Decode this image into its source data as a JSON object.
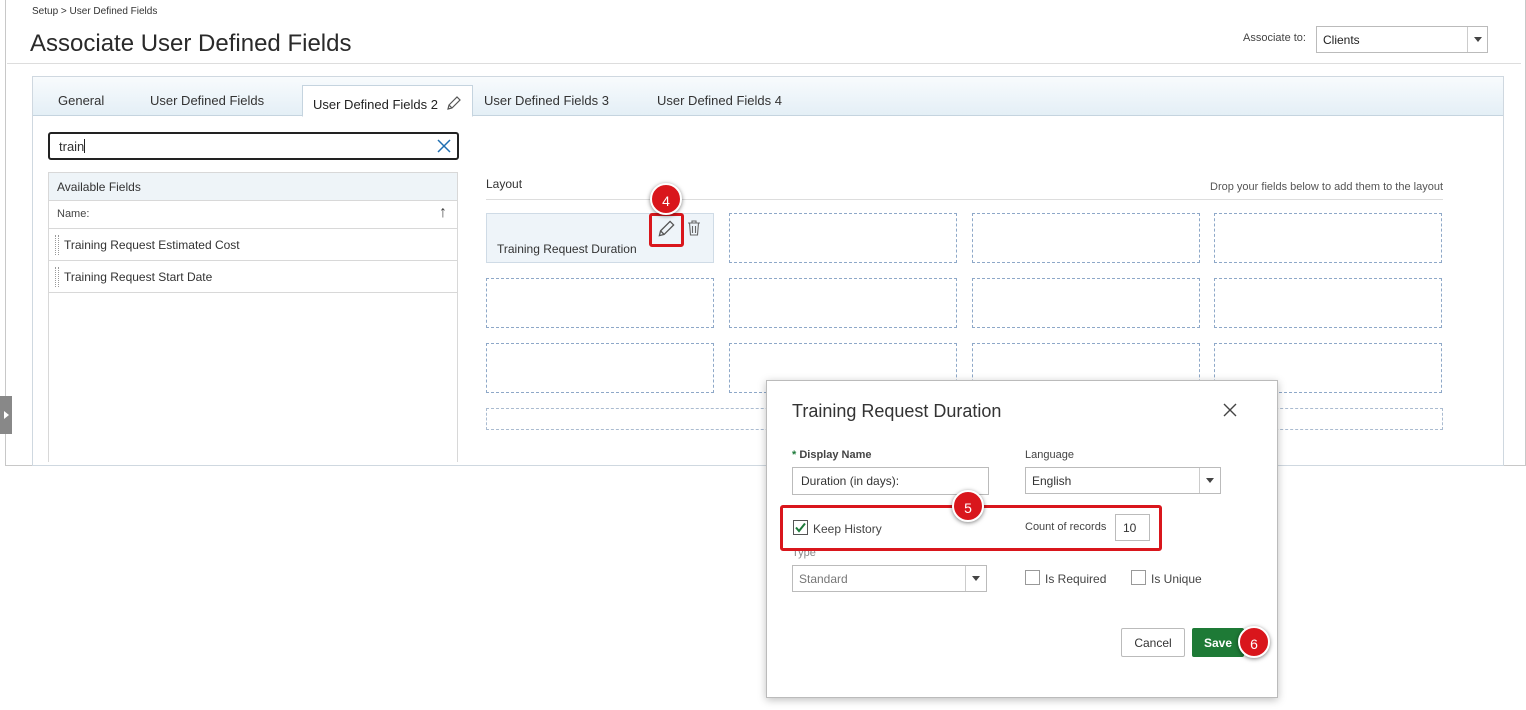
{
  "breadcrumb": "Setup > User Defined Fields",
  "page_title": "Associate User Defined Fields",
  "associate": {
    "label": "Associate to:",
    "value": "Clients"
  },
  "tabs": [
    {
      "label": "General"
    },
    {
      "label": "User Defined Fields"
    },
    {
      "label": "User Defined Fields 2",
      "active": true
    },
    {
      "label": "User Defined Fields 3"
    },
    {
      "label": "User Defined Fields 4"
    }
  ],
  "search": {
    "value": "train"
  },
  "available_fields": {
    "title": "Available Fields",
    "column_header": "Name:",
    "items": [
      {
        "label": "Training Request Estimated Cost"
      },
      {
        "label": "Training Request Start Date"
      }
    ]
  },
  "layout": {
    "label": "Layout",
    "hint": "Drop your fields below to add them to the layout",
    "placed_field": "Training Request Duration"
  },
  "markers": {
    "m4": "4",
    "m5": "5",
    "m6": "6"
  },
  "dialog": {
    "title": "Training Request Duration",
    "display_name_label": "Display Name",
    "required_mark": "*",
    "display_name_value": "Duration (in days):",
    "language_label": "Language",
    "language_value": "English",
    "keep_history_label": "Keep History",
    "keep_history_checked": true,
    "count_label": "Count of records",
    "count_value": "10",
    "type_label": "Type",
    "type_value": "Standard",
    "is_required_label": "Is Required",
    "is_unique_label": "Is Unique",
    "cancel_label": "Cancel",
    "save_label": "Save"
  },
  "colors": {
    "accent_red": "#d9161c",
    "save_green": "#1e7a36",
    "required_green": "#1d7a3a"
  }
}
